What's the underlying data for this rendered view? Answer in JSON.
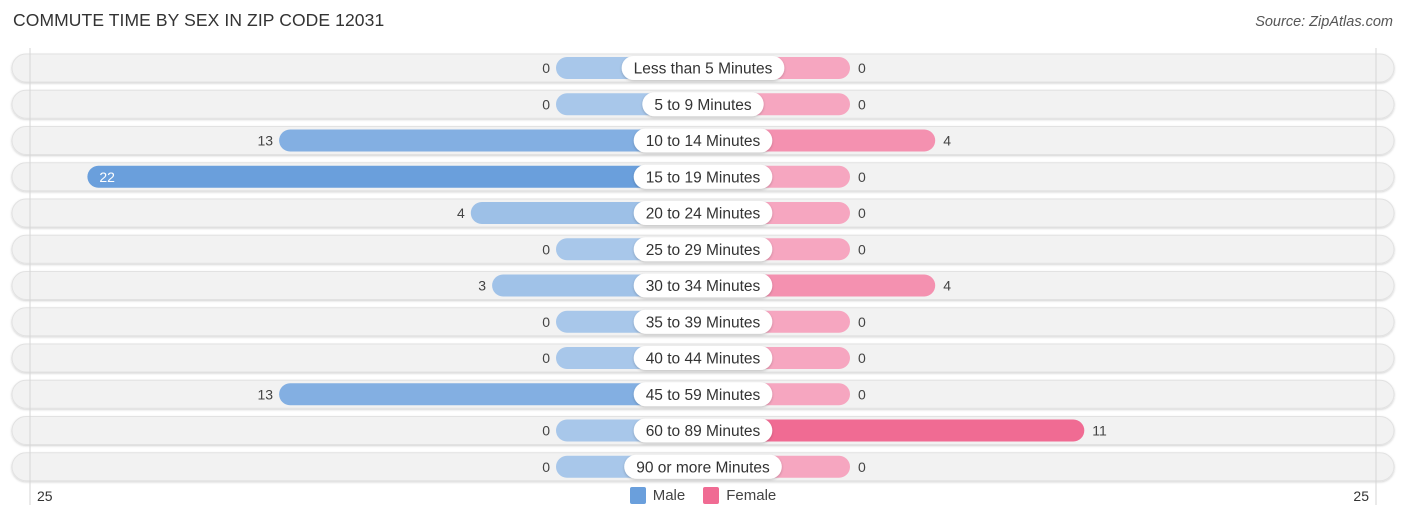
{
  "title": "COMMUTE TIME BY SEX IN ZIP CODE 12031",
  "source": "Source: ZipAtlas.com",
  "colors": {
    "male": "#6a9fdc",
    "male_light": "#a8c7ea",
    "female": "#f06b93",
    "female_light": "#f6a6c0",
    "row_bg": "#f2f2f2"
  },
  "legend": [
    {
      "label": "Male",
      "color": "#6a9fdc"
    },
    {
      "label": "Female",
      "color": "#f06b93"
    }
  ],
  "axis": {
    "left_label": "25",
    "right_label": "25"
  },
  "chart_data": {
    "type": "bar",
    "orientation": "horizontal-diverging",
    "title": "COMMUTE TIME BY SEX IN ZIP CODE 12031",
    "categories": [
      "Less than 5 Minutes",
      "5 to 9 Minutes",
      "10 to 14 Minutes",
      "15 to 19 Minutes",
      "20 to 24 Minutes",
      "25 to 29 Minutes",
      "30 to 34 Minutes",
      "35 to 39 Minutes",
      "40 to 44 Minutes",
      "45 to 59 Minutes",
      "60 to 89 Minutes",
      "90 or more Minutes"
    ],
    "series": [
      {
        "name": "Male",
        "values": [
          0,
          0,
          13,
          22,
          4,
          0,
          3,
          0,
          0,
          13,
          0,
          0
        ]
      },
      {
        "name": "Female",
        "values": [
          0,
          0,
          4,
          0,
          0,
          0,
          4,
          0,
          0,
          0,
          11,
          0
        ]
      }
    ],
    "xlim": [
      -25,
      25
    ],
    "xtick_labels": [
      "25",
      "25"
    ],
    "legend_position": "bottom-center",
    "grid": false
  }
}
